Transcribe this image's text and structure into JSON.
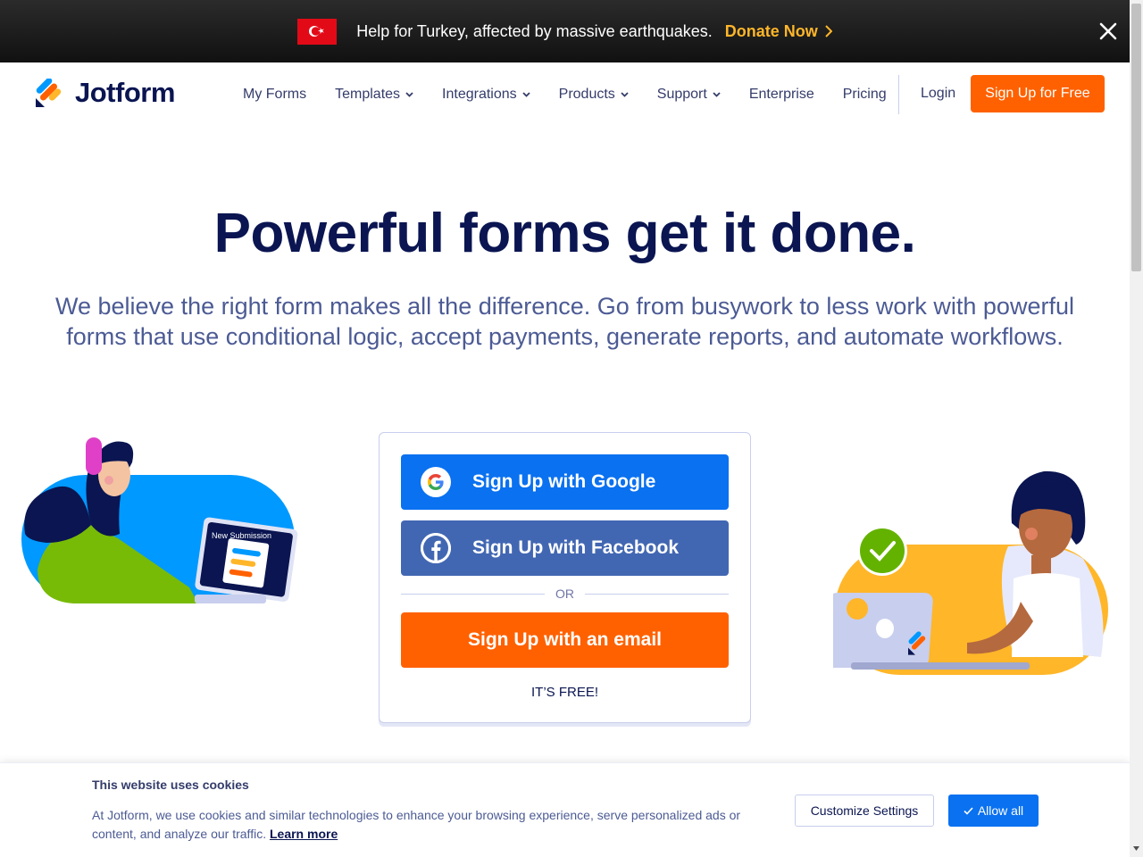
{
  "banner": {
    "message": "Help for Turkey, affected by massive earthquakes.",
    "donate_label": "Donate Now",
    "flag_icon": "turkey-flag-icon",
    "close_icon": "close-icon"
  },
  "nav": {
    "logo_text": "Jotform",
    "items": [
      {
        "label": "My Forms",
        "dropdown": false
      },
      {
        "label": "Templates",
        "dropdown": true
      },
      {
        "label": "Integrations",
        "dropdown": true
      },
      {
        "label": "Products",
        "dropdown": true
      },
      {
        "label": "Support",
        "dropdown": true
      },
      {
        "label": "Enterprise",
        "dropdown": false
      },
      {
        "label": "Pricing",
        "dropdown": false
      }
    ],
    "login_label": "Login",
    "signup_label": "Sign Up for Free"
  },
  "hero": {
    "title": "Powerful forms get it done.",
    "subtitle": "We believe the right form makes all the difference. Go from busywork to less work with powerful forms that use conditional logic, accept payments, generate reports, and automate workflows."
  },
  "signup_card": {
    "google_label": "Sign Up with Google",
    "facebook_label": "Sign Up with Facebook",
    "or_label": "OR",
    "email_label": "Sign Up with an email",
    "free_label": "IT’S FREE!"
  },
  "illustration_left": {
    "laptop_label": "New Submission"
  },
  "cookie_bar": {
    "title": "This website uses cookies",
    "text": "At Jotform, we use cookies and similar technologies to enhance your browsing experience, serve personalized ads or content, and analyze our traffic.",
    "learn_more": "Learn more",
    "customize_label": "Customize Settings",
    "allow_label": "Allow all"
  },
  "colors": {
    "brand_orange": "#ff6100",
    "brand_navy": "#0a1551",
    "google_blue": "#0a71f0",
    "facebook_blue": "#4267b2",
    "donate_yellow": "#ffb629"
  }
}
